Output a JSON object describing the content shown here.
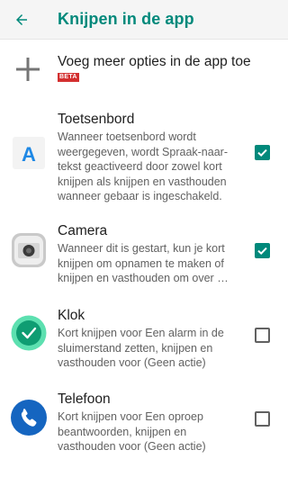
{
  "appbar": {
    "title": "Knijpen in de app",
    "back_icon": "arrow-back-icon",
    "accent_color": "#00897b"
  },
  "add_option": {
    "label": "Voeg meer opties in de app toe",
    "badge": "BETA",
    "icon": "plus-icon"
  },
  "apps": [
    {
      "title": "Toetsenbord",
      "description": "Wanneer toetsenbord wordt weergegeven, wordt Spraak-naar-tekst geactiveerd door zowel kort knijpen als knijpen en vasthouden wanneer gebaar is ingeschakeld.",
      "icon": "keyboard-app-icon",
      "checked": true
    },
    {
      "title": "Camera",
      "description": "Wanneer dit is gestart, kun je kort knijpen om opnamen te maken of knijpen en vasthouden om over …",
      "icon": "camera-app-icon",
      "checked": true
    },
    {
      "title": "Klok",
      "description": "Kort knijpen voor Een alarm in de sluimerstand zetten, knijpen en vasthouden voor (Geen actie)",
      "icon": "clock-app-icon",
      "checked": false
    },
    {
      "title": "Telefoon",
      "description": "Kort knijpen voor Een oproep beantwoorden, knijpen en vasthouden voor (Geen actie)",
      "icon": "phone-app-icon",
      "checked": false
    }
  ]
}
